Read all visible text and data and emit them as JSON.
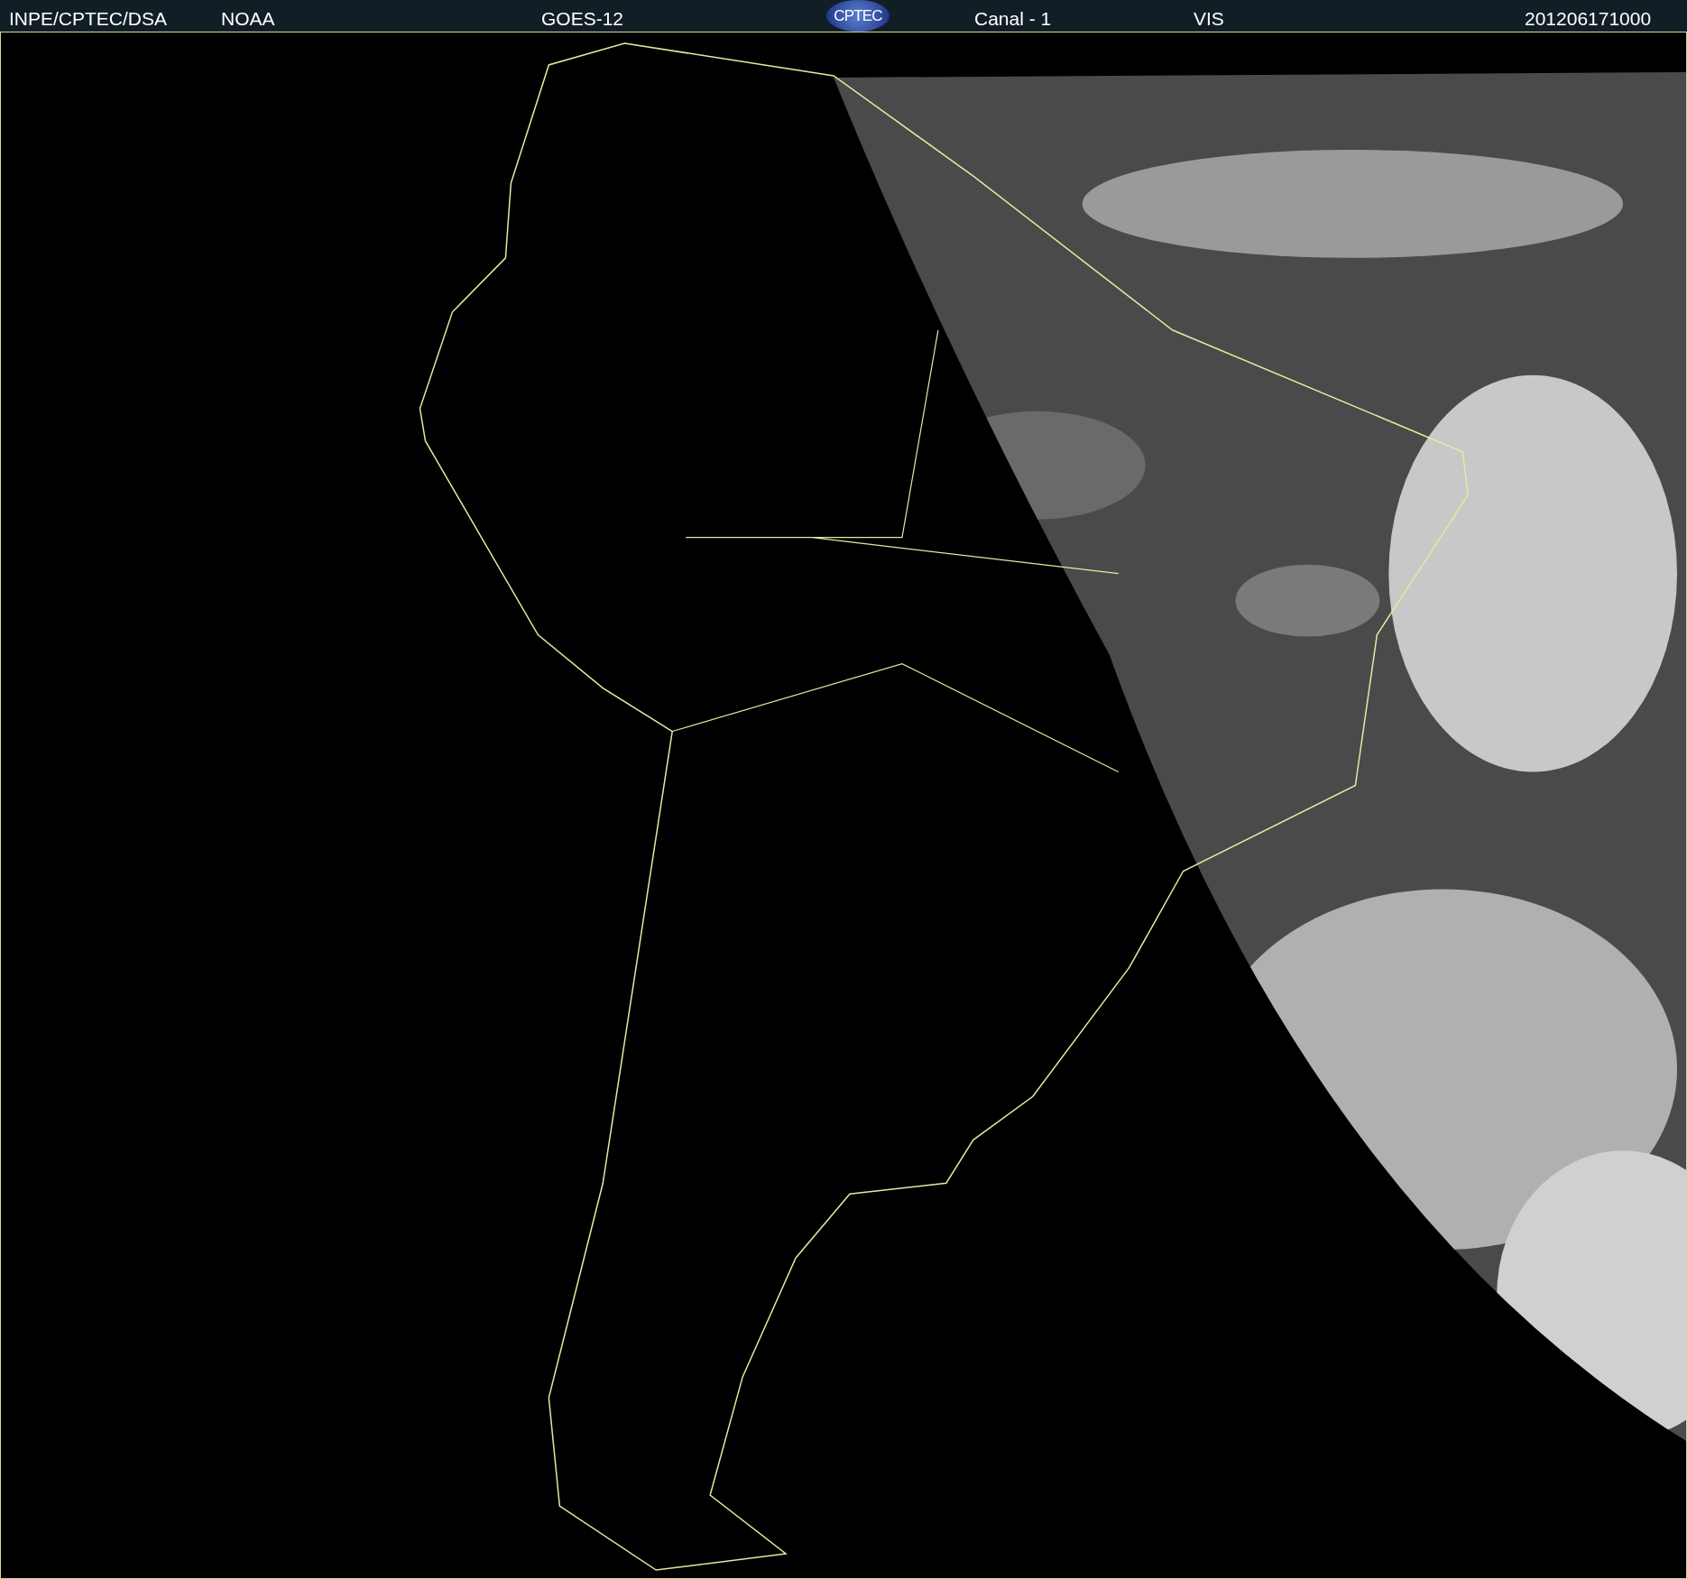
{
  "header": {
    "labels": [
      "INPE/CPTEC/DSA",
      "NOAA",
      "GOES-12"
    ],
    "logo": "CPTEC",
    "channel": "Canal - 1",
    "band": "VIS",
    "timestamp": "201206171000"
  }
}
